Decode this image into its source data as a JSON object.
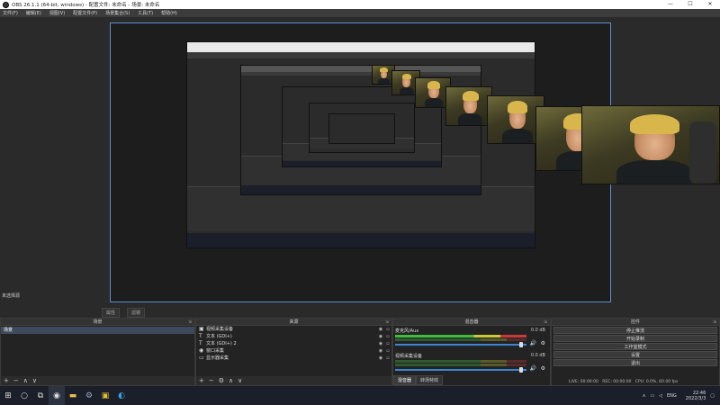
{
  "window": {
    "title": "OBS 26.1.1 (64-bit, windows) - 配置文件: 未命名 - 场景: 未命名"
  },
  "window_controls": {
    "minimize": "—",
    "maximize": "☐",
    "close": "✕"
  },
  "menu": [
    "文件(F)",
    "编辑(E)",
    "视图(V)",
    "配置文件(P)",
    "场景集合(S)",
    "工具(T)",
    "帮助(H)"
  ],
  "preview": {
    "scene_label": "未选择源",
    "buttons": [
      "属性",
      "滤镜"
    ]
  },
  "docks": {
    "scenes": {
      "title": "场景",
      "items": [
        "场景"
      ]
    },
    "sources": {
      "title": "来源",
      "items": [
        {
          "icon": "camera",
          "label": "视频采集设备"
        },
        {
          "icon": "text",
          "label": "文本 (GDI+)"
        },
        {
          "icon": "text",
          "label": "文本 (GDI+) 2"
        },
        {
          "icon": "eye",
          "label": "窗口采集"
        },
        {
          "icon": "monitor",
          "label": "显示器采集"
        }
      ]
    },
    "mixer": {
      "title": "混音器",
      "channels": [
        {
          "name": "麦克风/Aux",
          "db": "0.0 dB"
        },
        {
          "name": "视频采集设备",
          "db": "0.0 dB"
        }
      ],
      "tabs": [
        "混音器",
        "转场特效"
      ]
    },
    "controls": {
      "title": "控件",
      "buttons": [
        "停止推流",
        "开始录制",
        "工作室模式",
        "设置",
        "退出"
      ]
    }
  },
  "toolbar_glyphs": {
    "add": "+",
    "remove": "−",
    "up": "∧",
    "down": "∨",
    "gear": "⚙"
  },
  "status": {
    "live": "LIVE: 00:00:00",
    "rec": "REC: 00:00:00",
    "cpu": "CPU: 0.0%, 60.00 fps"
  },
  "taskbar": {
    "tray_lang": "ENG",
    "time": "22:46",
    "date": "2022/3/3"
  }
}
